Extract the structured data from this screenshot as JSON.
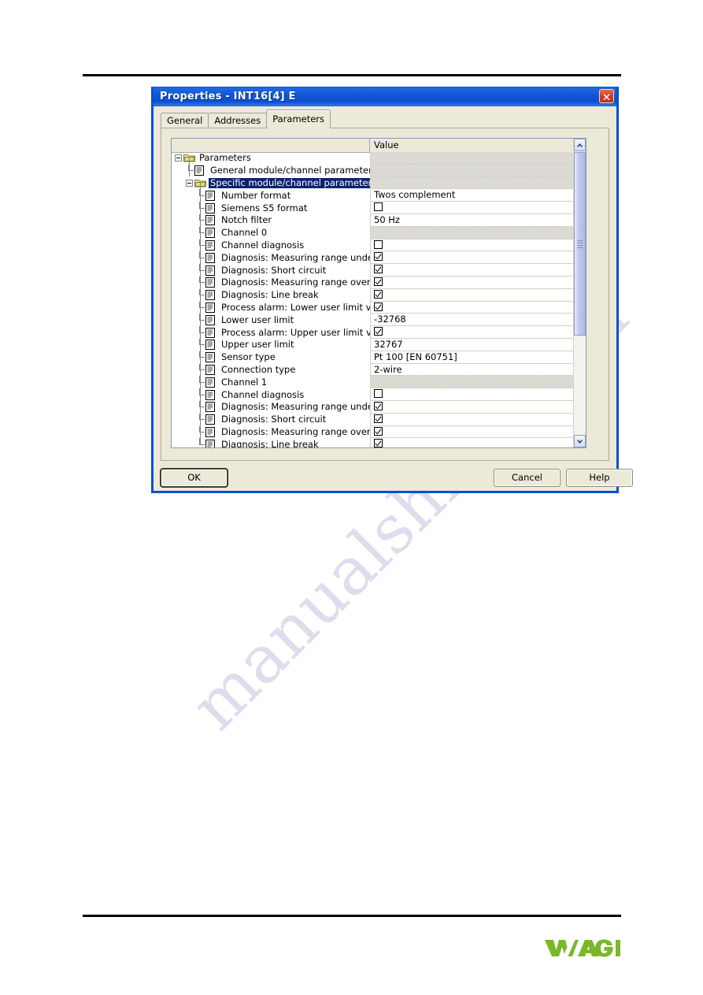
{
  "dialog": {
    "title": "Properties - INT16[4] E",
    "close_icon": "close-icon",
    "tabs": [
      {
        "label": "General",
        "active": false
      },
      {
        "label": "Addresses",
        "active": false
      },
      {
        "label": "Parameters",
        "active": true
      }
    ],
    "grid": {
      "columns": [
        "",
        "Value"
      ],
      "rows": [
        {
          "label": "Parameters",
          "depth": 0,
          "icon": "folder-icon",
          "expander": "minus",
          "value": "",
          "value_type": "disabled",
          "selected": false
        },
        {
          "label": "General module/channel parameters",
          "depth": 1,
          "icon": "document-icon",
          "expander": "none",
          "value": "",
          "value_type": "disabled",
          "selected": false
        },
        {
          "label": "Specific module/channel parameters",
          "depth": 1,
          "icon": "folder-icon",
          "expander": "minus",
          "value": "",
          "value_type": "disabled",
          "selected": true
        },
        {
          "label": "Number format",
          "depth": 2,
          "icon": "document-icon",
          "expander": "none",
          "value": "Twos complement",
          "value_type": "text",
          "selected": false
        },
        {
          "label": "Siemens S5 format",
          "depth": 2,
          "icon": "document-icon",
          "expander": "none",
          "value": "",
          "value_type": "checkbox-unchecked",
          "selected": false
        },
        {
          "label": "Notch filter",
          "depth": 2,
          "icon": "document-icon",
          "expander": "none",
          "value": "50 Hz",
          "value_type": "text",
          "selected": false
        },
        {
          "label": "Channel 0",
          "depth": 2,
          "icon": "document-icon",
          "expander": "none",
          "value": "",
          "value_type": "disabled",
          "selected": false
        },
        {
          "label": "Channel diagnosis",
          "depth": 2,
          "icon": "document-icon",
          "expander": "none",
          "value": "",
          "value_type": "checkbox-unchecked",
          "selected": false
        },
        {
          "label": "Diagnosis: Measuring range unde…",
          "depth": 2,
          "icon": "document-icon",
          "expander": "none",
          "value": "",
          "value_type": "checkbox-checked",
          "selected": false
        },
        {
          "label": "Diagnosis: Short circuit",
          "depth": 2,
          "icon": "document-icon",
          "expander": "none",
          "value": "",
          "value_type": "checkbox-checked",
          "selected": false
        },
        {
          "label": "Diagnosis: Measuring range overflow",
          "depth": 2,
          "icon": "document-icon",
          "expander": "none",
          "value": "",
          "value_type": "checkbox-checked",
          "selected": false
        },
        {
          "label": "Diagnosis: Line break",
          "depth": 2,
          "icon": "document-icon",
          "expander": "none",
          "value": "",
          "value_type": "checkbox-checked",
          "selected": false
        },
        {
          "label": "Process alarm: Lower user limit v…",
          "depth": 2,
          "icon": "document-icon",
          "expander": "none",
          "value": "",
          "value_type": "checkbox-checked",
          "selected": false
        },
        {
          "label": "Lower user limit",
          "depth": 2,
          "icon": "document-icon",
          "expander": "none",
          "value": "-32768",
          "value_type": "text",
          "selected": false
        },
        {
          "label": "Process alarm: Upper user limit v…",
          "depth": 2,
          "icon": "document-icon",
          "expander": "none",
          "value": "",
          "value_type": "checkbox-checked",
          "selected": false
        },
        {
          "label": "Upper user limit",
          "depth": 2,
          "icon": "document-icon",
          "expander": "none",
          "value": "32767",
          "value_type": "text",
          "selected": false
        },
        {
          "label": "Sensor type",
          "depth": 2,
          "icon": "document-icon",
          "expander": "none",
          "value": "Pt 100 [EN 60751]",
          "value_type": "text",
          "selected": false
        },
        {
          "label": "Connection type",
          "depth": 2,
          "icon": "document-icon",
          "expander": "none",
          "value": "2-wire",
          "value_type": "text",
          "selected": false
        },
        {
          "label": "Channel 1",
          "depth": 2,
          "icon": "document-icon",
          "expander": "none",
          "value": "",
          "value_type": "disabled",
          "selected": false
        },
        {
          "label": "Channel diagnosis",
          "depth": 2,
          "icon": "document-icon",
          "expander": "none",
          "value": "",
          "value_type": "checkbox-unchecked",
          "selected": false
        },
        {
          "label": "Diagnosis: Measuring range unde…",
          "depth": 2,
          "icon": "document-icon",
          "expander": "none",
          "value": "",
          "value_type": "checkbox-checked",
          "selected": false
        },
        {
          "label": "Diagnosis: Short circuit",
          "depth": 2,
          "icon": "document-icon",
          "expander": "none",
          "value": "",
          "value_type": "checkbox-checked",
          "selected": false
        },
        {
          "label": "Diagnosis: Measuring range overflow",
          "depth": 2,
          "icon": "document-icon",
          "expander": "none",
          "value": "",
          "value_type": "checkbox-checked",
          "selected": false
        },
        {
          "label": "Diagnosis: Line break",
          "depth": 2,
          "icon": "document-icon",
          "expander": "none",
          "value": "",
          "value_type": "checkbox-checked",
          "selected": false
        }
      ]
    },
    "scrollbar": {
      "up_icon": "chevron-up-icon",
      "down_icon": "chevron-down-icon"
    },
    "buttons": {
      "ok": "OK",
      "cancel": "Cancel",
      "help": "Help"
    }
  },
  "page": {
    "logo_text": "WAGO",
    "logo_color": "#7ab829"
  },
  "watermark": {
    "line1": "manualshive.com",
    "line2": ""
  }
}
